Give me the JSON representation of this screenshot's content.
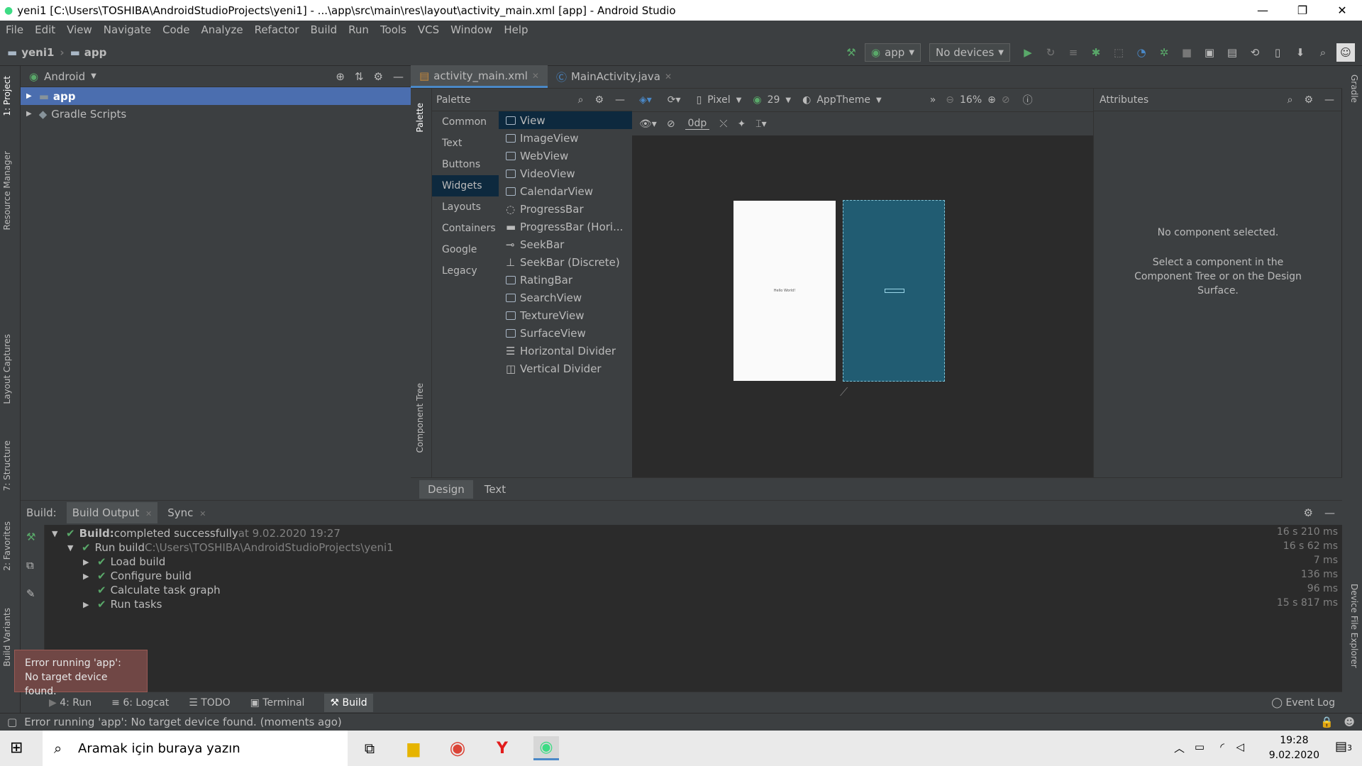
{
  "window": {
    "title": "yeni1 [C:\\Users\\TOSHIBA\\AndroidStudioProjects\\yeni1] - ...\\app\\src\\main\\res\\layout\\activity_main.xml [app] - Android Studio"
  },
  "menu": [
    "File",
    "Edit",
    "View",
    "Navigate",
    "Code",
    "Analyze",
    "Refactor",
    "Build",
    "Run",
    "Tools",
    "VCS",
    "Window",
    "Help"
  ],
  "toolbar": {
    "breadcrumb_project": "yeni1",
    "breadcrumb_module": "app",
    "run_config": "app",
    "device": "No devices"
  },
  "left_strip": {
    "project": "1: Project",
    "resource_manager": "Resource Manager",
    "layout_captures": "Layout Captures",
    "structure": "7: Structure",
    "favorites": "2: Favorites",
    "build_variants": "Build Variants"
  },
  "right_strip": {
    "gradle": "Gradle",
    "device_file_explorer": "Device File Explorer"
  },
  "project_panel": {
    "view_mode": "Android",
    "items": [
      {
        "label": "app"
      },
      {
        "label": "Gradle Scripts"
      }
    ]
  },
  "editor_tabs": [
    {
      "label": "activity_main.xml"
    },
    {
      "label": "MainActivity.java"
    }
  ],
  "palette": {
    "title": "Palette",
    "strip_palette": "Palette",
    "strip_component_tree": "Component Tree",
    "categories": [
      "Common",
      "Text",
      "Buttons",
      "Widgets",
      "Layouts",
      "Containers",
      "Google",
      "Legacy"
    ],
    "widgets": [
      "View",
      "ImageView",
      "WebView",
      "VideoView",
      "CalendarView",
      "ProgressBar",
      "ProgressBar (Hori...",
      "SeekBar",
      "SeekBar (Discrete)",
      "RatingBar",
      "SearchView",
      "TextureView",
      "SurfaceView",
      "Horizontal Divider",
      "Vertical Divider"
    ]
  },
  "design_toolbar": {
    "device": "Pixel",
    "api": "29",
    "theme": "AppTheme",
    "zoom": "16%",
    "margin": "0dp"
  },
  "preview": {
    "hello_text": "Hello World!"
  },
  "attributes": {
    "title": "Attributes",
    "empty_title": "No component selected.",
    "empty_hint": "Select a component in the Component Tree or on the Design Surface."
  },
  "design_tabs": [
    "Design",
    "Text"
  ],
  "build_panel": {
    "label": "Build:",
    "tabs": [
      "Build Output",
      "Sync"
    ],
    "rows": [
      {
        "bold": "Build:",
        "text": " completed successfully",
        "meta": " at 9.02.2020 19:27",
        "time": "16 s 210 ms"
      },
      {
        "bold": "",
        "text": "Run build",
        "meta": " C:\\Users\\TOSHIBA\\AndroidStudioProjects\\yeni1",
        "time": "16 s 62 ms"
      },
      {
        "bold": "",
        "text": "Load build",
        "meta": "",
        "time": "7 ms"
      },
      {
        "bold": "",
        "text": "Configure build",
        "meta": "",
        "time": "136 ms"
      },
      {
        "bold": "",
        "text": "Calculate task graph",
        "meta": "",
        "time": "96 ms"
      },
      {
        "bold": "",
        "text": "Run tasks",
        "meta": "",
        "time": "15 s 817 ms"
      }
    ]
  },
  "error_popup": {
    "line1": "Error running 'app':",
    "line2": "No target device found."
  },
  "bottom_tabs": [
    "4: Run",
    "6: Logcat",
    "TODO",
    "Terminal",
    "Build"
  ],
  "event_log": "Event Log",
  "status_text": "Error running 'app': No target device found. (moments ago)",
  "taskbar": {
    "search_placeholder": "Aramak için buraya yazın",
    "time": "19:28",
    "date": "9.02.2020",
    "notifications": "3"
  }
}
